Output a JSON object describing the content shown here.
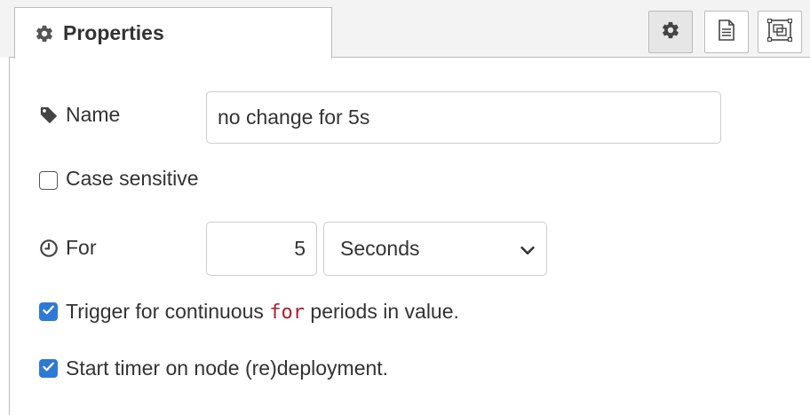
{
  "tabs": {
    "active_label": "Properties"
  },
  "form": {
    "name": {
      "label": "Name",
      "value": "no change for 5s"
    },
    "case_sensitive": {
      "label": "Case sensitive",
      "checked": false
    },
    "for": {
      "label": "For",
      "value": "5",
      "unit_selected": "Seconds"
    },
    "trigger_continuous": {
      "checked": true,
      "text_before": "Trigger for continuous",
      "code": "for",
      "text_after": "periods in value."
    },
    "start_timer": {
      "checked": true,
      "label": "Start timer on node (re)deployment."
    }
  },
  "icons": {
    "tab": "cog-icon",
    "settings_button": "cog-icon",
    "description_button": "file-text-icon",
    "appearance_button": "object-group-icon",
    "name": "tag-icon",
    "for": "clock-icon",
    "select": "chevron-down-icon"
  },
  "colors": {
    "accent_checkbox": "#2f79d6",
    "code_text": "#aa1f2a"
  }
}
